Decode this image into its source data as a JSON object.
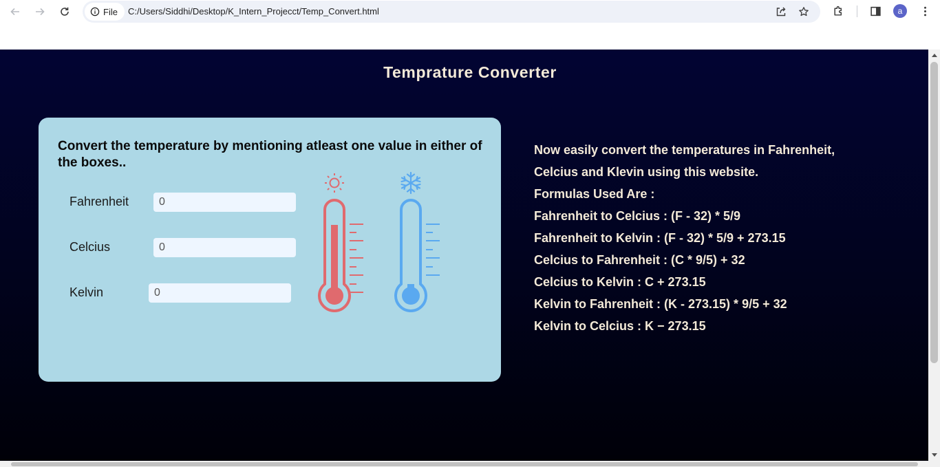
{
  "browser": {
    "back_icon": "arrow-left-icon",
    "forward_icon": "arrow-right-icon",
    "reload_icon": "reload-icon",
    "site_info_label": "File",
    "url": "C:/Users/Siddhi/Desktop/K_Intern_Projecct/Temp_Convert.html",
    "profile_initial": "a"
  },
  "page": {
    "title": "Temprature Converter"
  },
  "converter": {
    "heading": "Convert the temperature by mentioning atleast one value in either of the boxes..",
    "fields": [
      {
        "label": "Fahrenheit",
        "value": "0"
      },
      {
        "label": "Celcius",
        "value": "0"
      },
      {
        "label": "Kelvin",
        "value": "0"
      }
    ],
    "illustration_colors": {
      "hot": "#e06a6e",
      "cold": "#5aa9f0"
    }
  },
  "info": {
    "lines": [
      "Now easily convert the temperatures in Fahrenheit,",
      "Celcius and Klevin using this website.",
      "Formulas Used Are  :",
      "Fahrenheit to Celcius  :   (F - 32) * 5/9",
      "Fahrenheit to Kelvin  :   (F - 32) * 5/9 + 273.15",
      "Celcius to Fahrenheit :   (C * 9/5) + 32",
      "Celcius to Kelvin :  C + 273.15",
      "Kelvin to Fahrenheit :   (K - 273.15) * 9/5 + 32",
      "Kelvin to Celcius :  K − 273.15"
    ]
  }
}
